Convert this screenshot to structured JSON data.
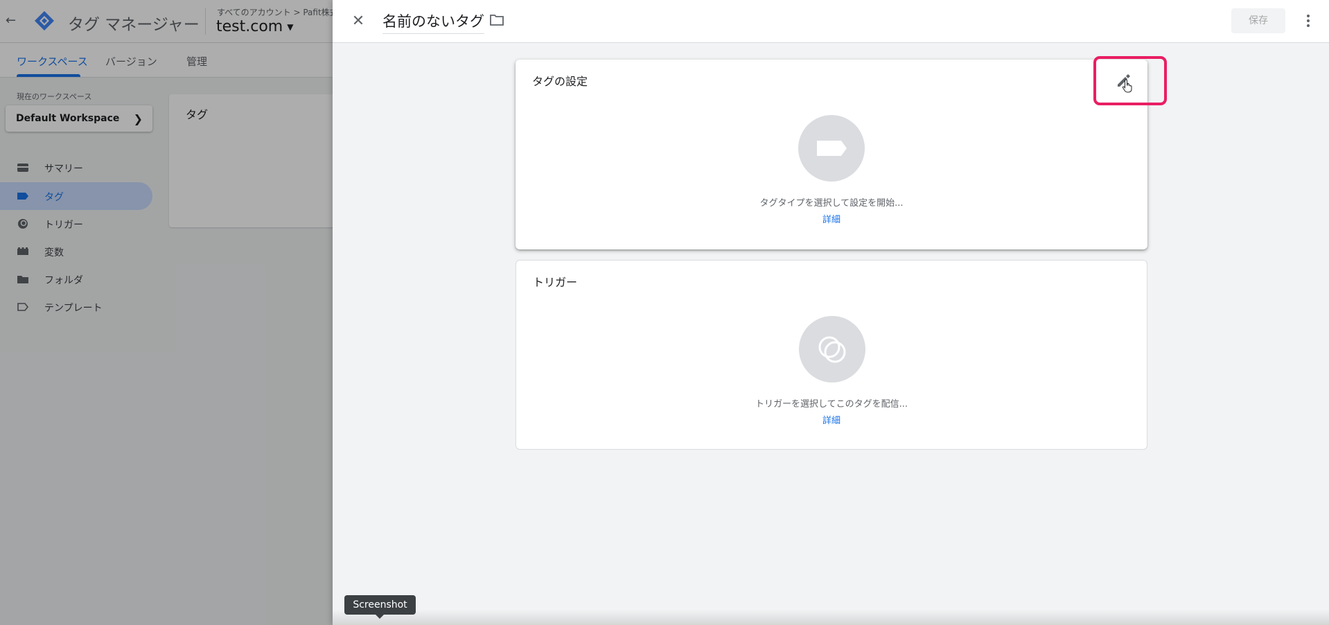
{
  "app": {
    "title": "タグ マネージャー",
    "breadcrumb": "すべてのアカウント > Pafit株式",
    "container_name": "test.com"
  },
  "nav": {
    "tabs": [
      {
        "label": "ワークスペース",
        "active": true
      },
      {
        "label": "バージョン",
        "active": false
      },
      {
        "label": "管理",
        "active": false
      }
    ]
  },
  "workspace": {
    "label": "現在のワークスペース",
    "current": "Default Workspace"
  },
  "sidebar": {
    "items": [
      {
        "label": "サマリー",
        "icon": "summary-icon",
        "active": false
      },
      {
        "label": "タグ",
        "icon": "tag-icon",
        "active": true
      },
      {
        "label": "トリガー",
        "icon": "trigger-icon",
        "active": false
      },
      {
        "label": "変数",
        "icon": "variable-icon",
        "active": false
      },
      {
        "label": "フォルダ",
        "icon": "folder-icon",
        "active": false
      },
      {
        "label": "テンプレート",
        "icon": "template-icon",
        "active": false
      }
    ]
  },
  "tags_panel": {
    "title": "タグ"
  },
  "sheet": {
    "tag_name": "名前のないタグ",
    "save_label": "保存",
    "tag_config": {
      "title": "タグの設定",
      "hint": "タグタイプを選択して設定を開始...",
      "link": "詳細"
    },
    "trigger": {
      "title": "トリガー",
      "hint": "トリガーを選択してこのタグを配信...",
      "link": "詳細"
    }
  },
  "tooltip": {
    "text": "Screenshot"
  },
  "colors": {
    "accent": "#1a73e8",
    "highlight": "#e91e63",
    "active_nav_bg": "#c8dafc",
    "disabled_text": "#a6a6a6"
  }
}
